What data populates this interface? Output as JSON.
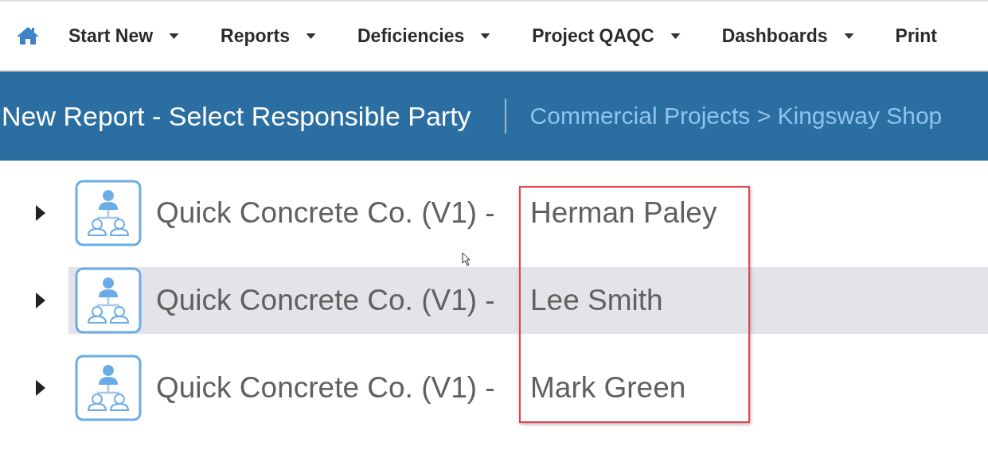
{
  "nav": {
    "items": [
      {
        "label": "Start New",
        "dropdown": true
      },
      {
        "label": "Reports",
        "dropdown": true
      },
      {
        "label": "Deficiencies",
        "dropdown": true
      },
      {
        "label": "Project QAQC",
        "dropdown": true
      },
      {
        "label": "Dashboards",
        "dropdown": true
      },
      {
        "label": "Print",
        "dropdown": false
      }
    ]
  },
  "header": {
    "title": "New Report - Select Responsible Party",
    "breadcrumb": "Commercial Projects > Kingsway Shop"
  },
  "parties": [
    {
      "company": "Quick Concrete Co. (V1) -",
      "contact": "Herman Paley",
      "selected": false,
      "expanded": false
    },
    {
      "company": "Quick Concrete Co. (V1) -",
      "contact": "Lee Smith",
      "selected": true,
      "expanded": false
    },
    {
      "company": "Quick Concrete Co. (V1) -",
      "contact": "Mark Green",
      "selected": false,
      "expanded": false
    }
  ],
  "annotation_box": true
}
